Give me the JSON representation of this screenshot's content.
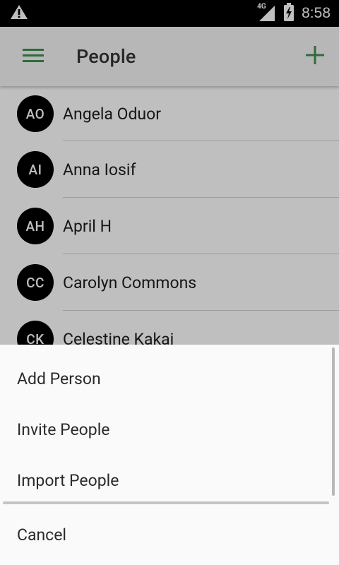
{
  "status_bar": {
    "time": "8:58",
    "network": "4G",
    "icons": [
      "warning-icon",
      "signal-icon",
      "battery-charging-icon"
    ]
  },
  "app_bar": {
    "title": "People",
    "menu_icon": "hamburger-menu-icon",
    "add_icon": "plus-icon",
    "accent_color": "#3f8f4f"
  },
  "people": [
    {
      "initials": "AO",
      "name": "Angela Oduor"
    },
    {
      "initials": "AI",
      "name": "Anna Iosif"
    },
    {
      "initials": "AH",
      "name": "April H"
    },
    {
      "initials": "CC",
      "name": "Carolyn Commons"
    },
    {
      "initials": "CK",
      "name": "Celestine Kakai"
    }
  ],
  "bottom_sheet": {
    "options": [
      "Add Person",
      "Invite People",
      "Import People"
    ],
    "cancel_label": "Cancel"
  }
}
